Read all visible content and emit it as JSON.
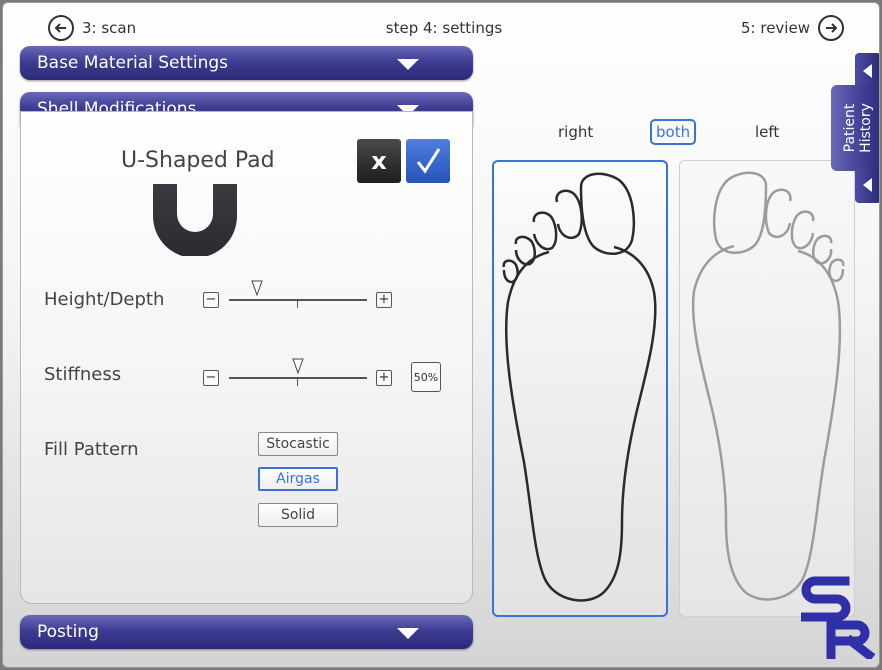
{
  "nav": {
    "back_label": "3: scan",
    "title": "step 4: settings",
    "next_label": "5: review"
  },
  "sections": {
    "base_material": "Base Material Settings",
    "shell_mods": "Shell Modifications",
    "posting": "Posting"
  },
  "shell": {
    "pad_title": "U-Shaped Pad",
    "cancel_label": "x",
    "height_label": "Height/Depth",
    "height_value": 0.2,
    "stiffness_label": "Stiffness",
    "stiffness_value": 0.5,
    "stiffness_pct": "50%",
    "fill_label": "Fill Pattern",
    "fill_options": [
      "Stocastic",
      "Airgas",
      "Solid"
    ],
    "fill_selected": "Airgas",
    "minus": "−",
    "plus": "+"
  },
  "feet": {
    "right_label": "right",
    "both_label": "both",
    "left_label": "left",
    "selected": "both"
  },
  "side_tab": {
    "label_line1": "Patient",
    "label_line2": "History"
  },
  "colors": {
    "accent": "#3a72d8",
    "bar": "#3f3d93",
    "logo": "#2f2fa8"
  },
  "icons": {
    "back": "arrow-left-circle-icon",
    "next": "arrow-right-circle-icon",
    "collapse": "chevron-down-icon",
    "confirm": "check-icon"
  }
}
